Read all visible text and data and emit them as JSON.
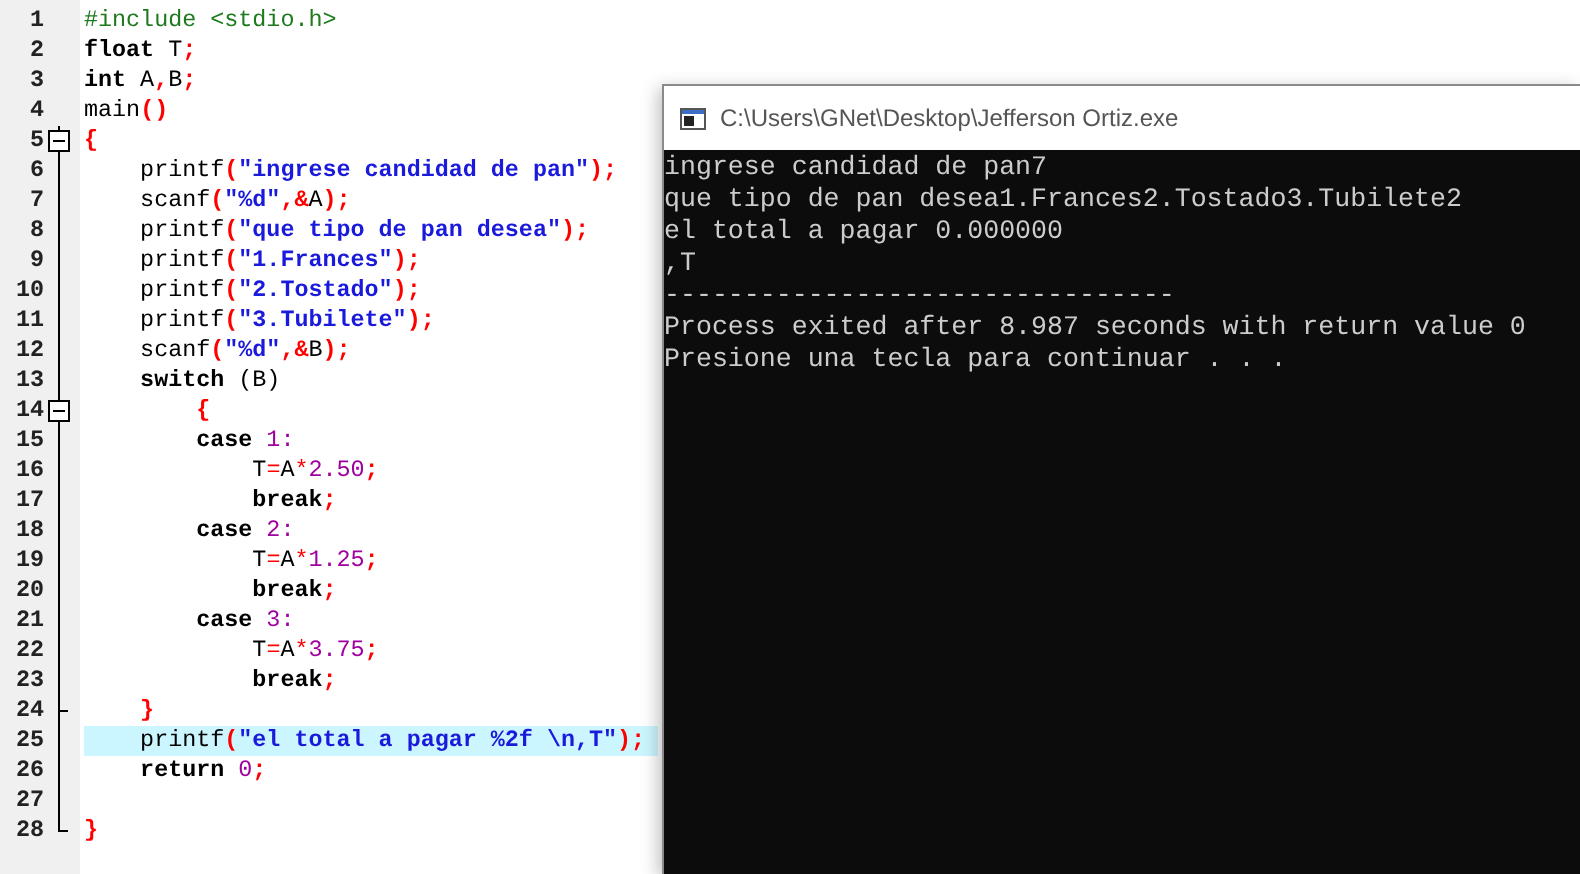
{
  "editor": {
    "lines": [
      {
        "number": "1",
        "tokens": [
          {
            "kind": "pre",
            "text": "#include <stdio.h>"
          }
        ]
      },
      {
        "number": "2",
        "tokens": [
          {
            "kind": "kw",
            "text": "float"
          },
          {
            "kind": "id",
            "text": " T"
          },
          {
            "kind": "punct",
            "text": ";"
          }
        ]
      },
      {
        "number": "3",
        "tokens": [
          {
            "kind": "kw",
            "text": "int"
          },
          {
            "kind": "id",
            "text": " A"
          },
          {
            "kind": "punct",
            "text": ","
          },
          {
            "kind": "id",
            "text": "B"
          },
          {
            "kind": "punct",
            "text": ";"
          }
        ]
      },
      {
        "number": "4",
        "tokens": [
          {
            "kind": "id",
            "text": "main"
          },
          {
            "kind": "punct",
            "text": "()"
          }
        ]
      },
      {
        "number": "5",
        "expanded": true,
        "tokens": [
          {
            "kind": "punct",
            "text": "{"
          }
        ]
      },
      {
        "number": "6",
        "tokens": [
          {
            "kind": "id",
            "text": "    printf"
          },
          {
            "kind": "punct",
            "text": "("
          },
          {
            "kind": "str",
            "text": "\"ingrese candidad de pan\""
          },
          {
            "kind": "punct",
            "text": ");"
          }
        ]
      },
      {
        "number": "7",
        "tokens": [
          {
            "kind": "id",
            "text": "    scanf"
          },
          {
            "kind": "punct",
            "text": "("
          },
          {
            "kind": "str",
            "text": "\"%d\""
          },
          {
            "kind": "punct",
            "text": ",&"
          },
          {
            "kind": "id",
            "text": "A"
          },
          {
            "kind": "punct",
            "text": ");"
          }
        ]
      },
      {
        "number": "8",
        "tokens": [
          {
            "kind": "id",
            "text": "    printf"
          },
          {
            "kind": "punct",
            "text": "("
          },
          {
            "kind": "str",
            "text": "\"que tipo de pan desea\""
          },
          {
            "kind": "punct",
            "text": ");"
          }
        ]
      },
      {
        "number": "9",
        "tokens": [
          {
            "kind": "id",
            "text": "    printf"
          },
          {
            "kind": "punct",
            "text": "("
          },
          {
            "kind": "str",
            "text": "\"1.Frances\""
          },
          {
            "kind": "punct",
            "text": ");"
          }
        ]
      },
      {
        "number": "10",
        "tokens": [
          {
            "kind": "id",
            "text": "    printf"
          },
          {
            "kind": "punct",
            "text": "("
          },
          {
            "kind": "str",
            "text": "\"2.Tostado\""
          },
          {
            "kind": "punct",
            "text": ");"
          }
        ]
      },
      {
        "number": "11",
        "tokens": [
          {
            "kind": "id",
            "text": "    printf"
          },
          {
            "kind": "punct",
            "text": "("
          },
          {
            "kind": "str",
            "text": "\"3.Tubilete\""
          },
          {
            "kind": "punct",
            "text": ");"
          }
        ]
      },
      {
        "number": "12",
        "tokens": [
          {
            "kind": "id",
            "text": "    scanf"
          },
          {
            "kind": "punct",
            "text": "("
          },
          {
            "kind": "str",
            "text": "\"%d\""
          },
          {
            "kind": "punct",
            "text": ",&"
          },
          {
            "kind": "id",
            "text": "B"
          },
          {
            "kind": "punct",
            "text": ");"
          }
        ]
      },
      {
        "number": "13",
        "tokens": [
          {
            "kind": "kw",
            "text": "    switch"
          },
          {
            "kind": "id",
            "text": " (B)"
          }
        ]
      },
      {
        "number": "14",
        "expanded": true,
        "tokens": [
          {
            "kind": "punct",
            "text": "        {"
          }
        ]
      },
      {
        "number": "15",
        "tokens": [
          {
            "kind": "kw",
            "text": "        case"
          },
          {
            "kind": "num",
            "text": " 1:"
          }
        ]
      },
      {
        "number": "16",
        "tokens": [
          {
            "kind": "id",
            "text": "            T"
          },
          {
            "kind": "op",
            "text": "="
          },
          {
            "kind": "id",
            "text": "A"
          },
          {
            "kind": "op",
            "text": "*"
          },
          {
            "kind": "num",
            "text": "2.50"
          },
          {
            "kind": "punct",
            "text": ";"
          }
        ]
      },
      {
        "number": "17",
        "tokens": [
          {
            "kind": "kw",
            "text": "            break"
          },
          {
            "kind": "punct",
            "text": ";"
          }
        ]
      },
      {
        "number": "18",
        "tokens": [
          {
            "kind": "kw",
            "text": "        case"
          },
          {
            "kind": "num",
            "text": " 2:"
          }
        ]
      },
      {
        "number": "19",
        "tokens": [
          {
            "kind": "id",
            "text": "            T"
          },
          {
            "kind": "op",
            "text": "="
          },
          {
            "kind": "id",
            "text": "A"
          },
          {
            "kind": "op",
            "text": "*"
          },
          {
            "kind": "num",
            "text": "1.25"
          },
          {
            "kind": "punct",
            "text": ";"
          }
        ]
      },
      {
        "number": "20",
        "tokens": [
          {
            "kind": "kw",
            "text": "            break"
          },
          {
            "kind": "punct",
            "text": ";"
          }
        ]
      },
      {
        "number": "21",
        "tokens": [
          {
            "kind": "kw",
            "text": "        case"
          },
          {
            "kind": "num",
            "text": " 3:"
          }
        ]
      },
      {
        "number": "22",
        "tokens": [
          {
            "kind": "id",
            "text": "            T"
          },
          {
            "kind": "op",
            "text": "="
          },
          {
            "kind": "id",
            "text": "A"
          },
          {
            "kind": "op",
            "text": "*"
          },
          {
            "kind": "num",
            "text": "3.75"
          },
          {
            "kind": "punct",
            "text": ";"
          }
        ]
      },
      {
        "number": "23",
        "tokens": [
          {
            "kind": "kw",
            "text": "            break"
          },
          {
            "kind": "punct",
            "text": ";"
          }
        ]
      },
      {
        "number": "24",
        "fold_end": true,
        "tokens": [
          {
            "kind": "punct",
            "text": "    }"
          }
        ]
      },
      {
        "number": "25",
        "current": true,
        "tokens": [
          {
            "kind": "id",
            "text": "    printf"
          },
          {
            "kind": "punct",
            "text": "("
          },
          {
            "kind": "str",
            "text": "\"el total a pagar %2f \\n,T\""
          },
          {
            "kind": "punct",
            "text": ");"
          }
        ]
      },
      {
        "number": "26",
        "tokens": [
          {
            "kind": "kw",
            "text": "    return"
          },
          {
            "kind": "num",
            "text": " 0"
          },
          {
            "kind": "punct",
            "text": ";"
          }
        ]
      },
      {
        "number": "27"
      },
      {
        "number": "28",
        "fold_end": true,
        "tokens": [
          {
            "kind": "punct",
            "text": "}"
          }
        ]
      }
    ]
  },
  "console": {
    "title": "C:\\Users\\GNet\\Desktop\\Jefferson Ortiz.exe",
    "lines": [
      "ingrese candidad de pan7",
      "que tipo de pan desea1.Frances2.Tostado3.Tubilete2",
      "el total a pagar 0.000000",
      ",T",
      "--------------------------------",
      "Process exited after 8.987 seconds with return value 0",
      "Presione una tecla para continuar . . ."
    ]
  }
}
